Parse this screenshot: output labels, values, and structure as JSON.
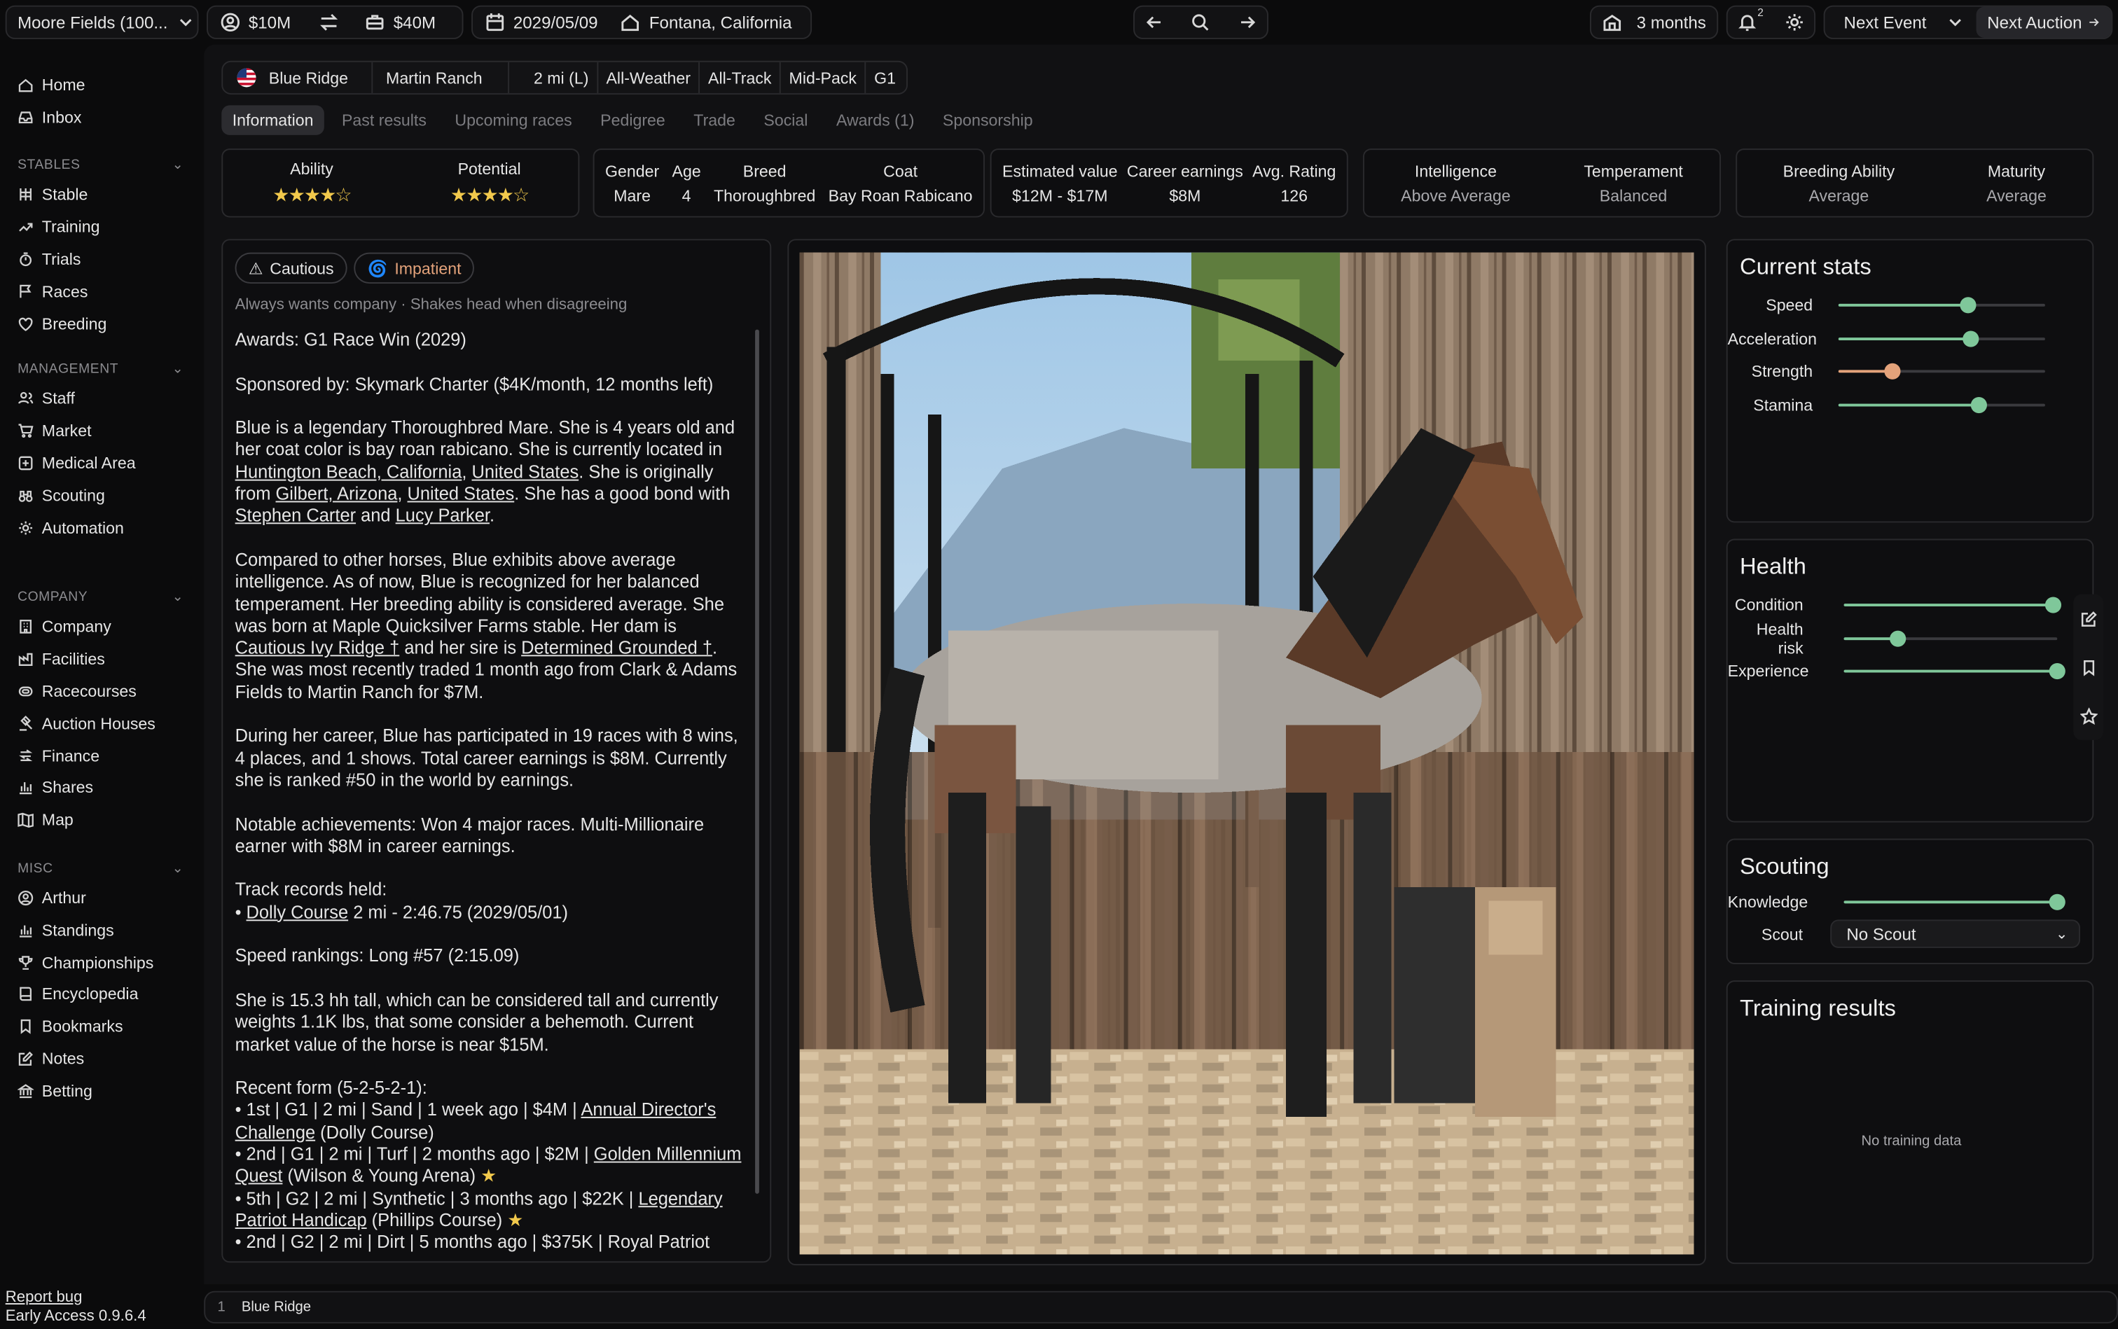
{
  "topbar": {
    "company": "Moore Fields (100...",
    "money_personal": "$10M",
    "money_company": "$40M",
    "date": "2029/05/09",
    "location": "Fontana, California",
    "duration": "3 months",
    "notif_count": "2",
    "next_event": "Next Event",
    "next_auction": "Next Auction"
  },
  "sidebar": {
    "top_items": [
      "Home",
      "Inbox"
    ],
    "sections": [
      {
        "title": "STABLES",
        "items": [
          "Stable",
          "Training",
          "Trials",
          "Races",
          "Breeding"
        ]
      },
      {
        "title": "MANAGEMENT",
        "items": [
          "Staff",
          "Market",
          "Medical Area",
          "Scouting",
          "Automation"
        ]
      },
      {
        "title": "COMPANY",
        "items": [
          "Company",
          "Facilities",
          "Racecourses",
          "Auction Houses",
          "Finance",
          "Shares",
          "Map"
        ]
      },
      {
        "title": "MISC",
        "items": [
          "Arthur",
          "Standings",
          "Championships",
          "Encyclopedia",
          "Bookmarks",
          "Notes",
          "Betting"
        ]
      }
    ],
    "report_bug": "Report bug",
    "version": "Early Access 0.9.6.4"
  },
  "horse": {
    "crumbs": [
      "Blue Ridge",
      "Martin Ranch",
      "2 mi (L)",
      "All-Weather",
      "All-Track",
      "Mid-Pack",
      "G1"
    ],
    "tabs": [
      "Information",
      "Past results",
      "Upcoming races",
      "Pedigree",
      "Trade",
      "Social",
      "Awards (1)",
      "Sponsorship"
    ],
    "ability_label": "Ability",
    "ability_stars": 4,
    "potential_label": "Potential",
    "potential_stars": 4,
    "gender_label": "Gender",
    "gender": "Mare",
    "age_label": "Age",
    "age": "4",
    "breed_label": "Breed",
    "breed": "Thoroughbred",
    "coat_label": "Coat",
    "coat": "Bay Roan Rabicano",
    "est_value_label": "Estimated value",
    "est_value": "$12M - $17M",
    "career_label": "Career earnings",
    "career": "$8M",
    "rating_label": "Avg. Rating",
    "rating": "126",
    "intel_label": "Intelligence",
    "intel": "Above Average",
    "temper_label": "Temperament",
    "temper": "Balanced",
    "breeding_label": "Breeding Ability",
    "breeding": "Average",
    "maturity_label": "Maturity",
    "maturity": "Average",
    "traits": [
      "Cautious",
      "Impatient"
    ],
    "quirks": [
      "Always wants company",
      "Shakes head when disagreeing"
    ]
  },
  "bio": {
    "awards": "Awards: G1 Race Win (2029)",
    "sponsor": "Sponsored by: Skymark Charter ($4K/month, 12 months left)",
    "p1a": "Blue is a legendary Thoroughbred Mare. She is 4 years old and her coat color is bay roan rabicano. She is currently located in ",
    "loc1": "Huntington Beach, California",
    "loc1b": "United States",
    "p1b": ". She is originally from ",
    "loc2": "Gilbert, Arizona",
    "loc2b": "United States",
    "p1c": ". She has a good bond with ",
    "person1": "Stephen Carter",
    "and": " and ",
    "person2": "Lucy Parker",
    "p2a": "Compared to other horses, Blue exhibits above average intelligence. As of now, Blue is recognized for her balanced temperament. Her breeding ability is considered average. She was born at Maple Quicksilver Farms stable. Her dam is ",
    "dam": "Cautious Ivy Ridge †",
    "p2b": " and her sire is ",
    "sire": "Determined Grounded †",
    "p2c": ". She was most recently traded 1 month ago from Clark & Adams Fields to Martin Ranch for $7M.",
    "p3": "During her career, Blue has participated in 19 races with 8 wins, 4 places, and 1 shows. Total career earnings is $8M. Currently she is ranked #50 in the world by earnings.",
    "p4": "Notable achievements: Won 4 major races. Multi-Millionaire earner with $8M in career earnings.",
    "records_title": "Track records held:",
    "record_course": "Dolly Course",
    "record_rest": " 2 mi - 2:46.75 (2029/05/01)",
    "speed_rank": "Speed rankings: Long #57 (2:15.09)",
    "p5": "She is 15.3 hh tall, which can be considered tall and currently weights 1.1K lbs, that some consider a behemoth. Current market value of the horse is near $15M.",
    "form_title": "Recent form (5-2-5-2-1):",
    "f1a": "• 1st | G1 | 2 mi | Sand | 1 week ago | $4M | ",
    "f1b": "Annual Director's Challenge",
    "f1c": " (Dolly Course)",
    "f2a": "• 2nd | G1 | 2 mi | Turf | 2 months ago | $2M | ",
    "f2b": "Golden Millennium Quest",
    "f2c": " (Wilson & Young Arena) ",
    "f3a": "• 5th | G2 | 2 mi | Synthetic | 3 months ago | $22K | ",
    "f3b": "Legendary Patriot Handicap",
    "f3c": " (Phillips Course) ",
    "f4": "• 2nd | G2 | 2 mi | Dirt | 5 months ago | $375K | Royal Patriot"
  },
  "current_stats": {
    "title": "Current stats",
    "items": [
      {
        "label": "Speed",
        "value": 0.63,
        "color": "#7fc79a"
      },
      {
        "label": "Acceleration",
        "value": 0.64,
        "color": "#7fc79a"
      },
      {
        "label": "Strength",
        "value": 0.26,
        "color": "#e3a27a"
      },
      {
        "label": "Stamina",
        "value": 0.68,
        "color": "#7fc79a"
      }
    ]
  },
  "health": {
    "title": "Health",
    "items": [
      {
        "label": "Condition",
        "value": 0.98,
        "color": "#7fc79a"
      },
      {
        "label": "Health risk",
        "value": 0.25,
        "color": "#7fc79a"
      },
      {
        "label": "Experience",
        "value": 1.0,
        "color": "#7fc79a"
      }
    ]
  },
  "scouting": {
    "title": "Scouting",
    "knowledge_label": "Knowledge",
    "knowledge": 1.0,
    "scout_label": "Scout",
    "scout_value": "No Scout"
  },
  "training": {
    "title": "Training results",
    "empty": "No training data"
  },
  "statusbar": {
    "index": "1",
    "name": "Blue Ridge"
  }
}
